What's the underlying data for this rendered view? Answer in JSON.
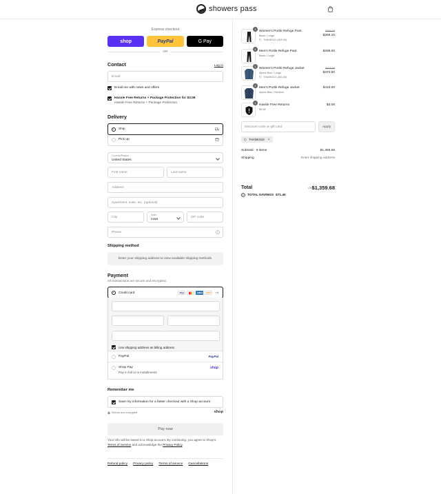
{
  "header": {
    "brand": "showers pass"
  },
  "express": {
    "title": "Express checkout",
    "shop_label": "shop",
    "paypal_label": "PayPal",
    "gpay_label": "G Pay",
    "or_label": "OR"
  },
  "contact": {
    "title": "Contact",
    "login_label": "Log in",
    "email_placeholder": "Email",
    "news_label": "Email me with news and offers",
    "protection_label": "Hassle Free Returns + Package Protection for $3.08",
    "protection_sub": "Hassle Free Returns + Package Protection"
  },
  "delivery": {
    "title": "Delivery",
    "options": [
      {
        "label": "Ship",
        "selected": true
      },
      {
        "label": "Pick up",
        "selected": false
      }
    ],
    "country_label": "Country/Region",
    "country_value": "United States",
    "first_name": "First name",
    "last_name": "Last name",
    "address": "Address",
    "apartment": "Apartment, suite, etc. (optional)",
    "city": "City",
    "state_label": "State",
    "state_value": "Iowa",
    "zip": "ZIP code",
    "phone": "Phone"
  },
  "shipping": {
    "title": "Shipping method",
    "message": "Enter your shipping address to view available shipping methods."
  },
  "payment": {
    "title": "Payment",
    "subtitle": "All transactions are secure and encrypted.",
    "credit_card_label": "Credit card",
    "card_logos": [
      {
        "text": "VISA",
        "color": "#1a1f71"
      },
      {
        "text": "MC",
        "color": "#eb001b"
      },
      {
        "text": "AMEX",
        "color": "#2e77bc"
      },
      {
        "text": "DISC",
        "color": "#f48120"
      }
    ],
    "more_cards": "+4",
    "billing_label": "Use shipping address as billing address",
    "paypal_label": "PayPal",
    "paypal_brand": "PayPal",
    "shoppay_label": "Shop Pay",
    "shoppay_desc": "Pay in full or in installments",
    "shoppay_brand": "shop"
  },
  "remember": {
    "title": "Remember me",
    "label": "Save my information for a faster checkout with a Shop account",
    "secure_label": "Secure and encrypted",
    "shop_brand": "shop"
  },
  "pay_now": "Pay now",
  "legal": {
    "text_before": "Your info will be saved to a Shop account. By continuing, you agree to Shop's ",
    "terms": "Terms of Service",
    "text_mid": " and acknowledge the ",
    "privacy": "Privacy Policy",
    "text_after": "."
  },
  "footer": {
    "links": [
      "Refund policy",
      "Privacy policy",
      "Terms of service",
      "Cancellations"
    ]
  },
  "summary": {
    "items": [
      {
        "qty": "1",
        "name": "Women's Portle Refuge Pant",
        "variant": "Black / Large",
        "discount": "THANKS10 (-$29.90)",
        "original": "$299.00",
        "price": "$269.10"
      },
      {
        "qty": "1",
        "name": "Men's Portle Refuge Pant",
        "variant": "Black / Large",
        "discount": "",
        "original": "",
        "price": "$299.00"
      },
      {
        "qty": "1",
        "name": "Women's Portle Refuge Jacket",
        "variant": "Alpine Blue / Large",
        "discount": "THANKS10 (-$41.50)",
        "original": "$415.00",
        "price": "$373.50"
      },
      {
        "qty": "1",
        "name": "Men's Portle Refuge Jacket",
        "variant": "Alpine Blue / Medium",
        "discount": "",
        "original": "",
        "price": "$415.00"
      },
      {
        "qty": "1",
        "name": "Hassle Free Returns",
        "variant": "$3.08",
        "discount": "",
        "original": "",
        "price": "$3.08"
      }
    ],
    "discount_placeholder": "Discount code or gift card",
    "apply_label": "Apply",
    "applied_code": "THANKS10",
    "subtotal_label": "Subtotal · 5 items",
    "subtotal_value": "$1,359.68",
    "shipping_label": "Shipping",
    "shipping_value": "Enter shipping address",
    "total_label": "Total",
    "currency": "USD",
    "total_value": "$1,359.68",
    "savings_label": "TOTAL SAVINGS",
    "savings_value": "$71.40"
  }
}
